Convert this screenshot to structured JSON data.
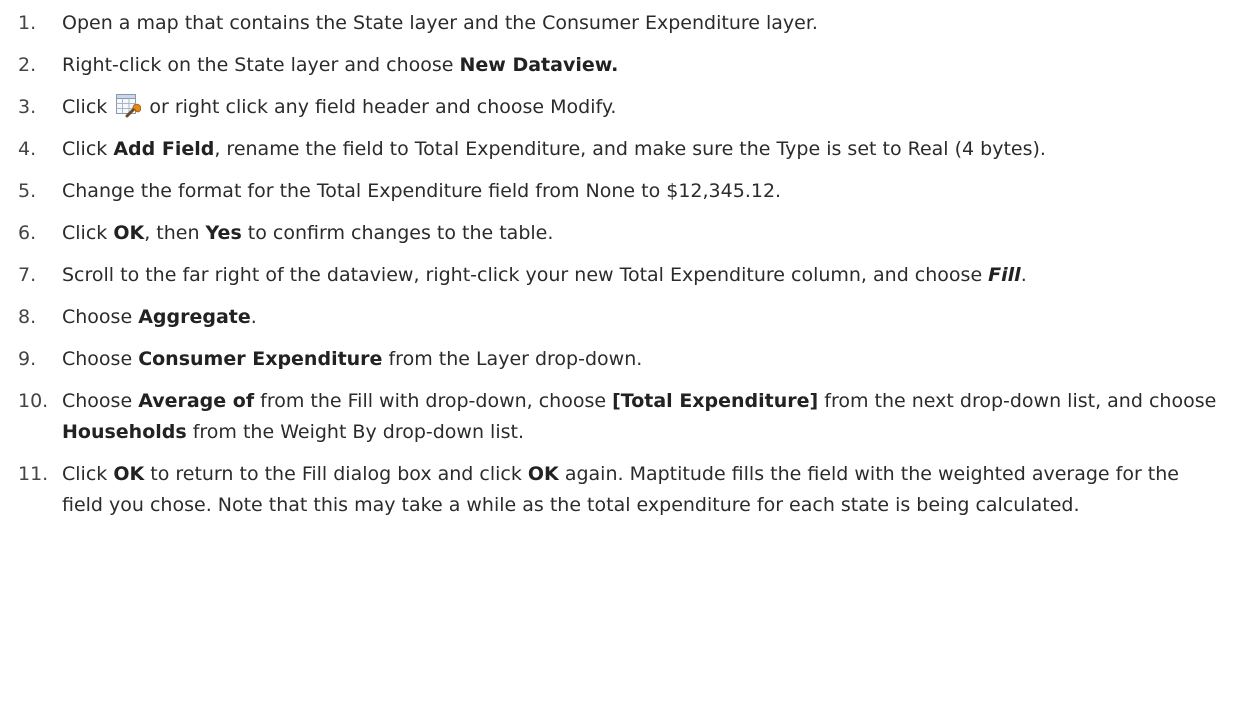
{
  "steps": [
    {
      "num": "1.",
      "parts": [
        {
          "t": "Open a map that contains the State layer and the Consumer Expenditure layer."
        }
      ]
    },
    {
      "num": "2.",
      "parts": [
        {
          "t": "Right-click on the State layer and choose "
        },
        {
          "t": "New Dataview.",
          "b": true
        }
      ]
    },
    {
      "num": "3.",
      "parts": [
        {
          "t": "Click "
        },
        {
          "icon": "modify-table-icon"
        },
        {
          "t": " or right click any field header and choose Modify."
        }
      ]
    },
    {
      "num": "4.",
      "parts": [
        {
          "t": "Click "
        },
        {
          "t": "Add Field",
          "b": true
        },
        {
          "t": ", rename the field to Total Expenditure, and make sure the Type is set to Real (4 bytes)."
        }
      ]
    },
    {
      "num": "5.",
      "parts": [
        {
          "t": "Change the format for the Total Expenditure field from None to $12,345.12."
        }
      ]
    },
    {
      "num": "6.",
      "parts": [
        {
          "t": "Click "
        },
        {
          "t": "OK",
          "b": true
        },
        {
          "t": ", then "
        },
        {
          "t": "Yes",
          "b": true
        },
        {
          "t": " to confirm changes to the table."
        }
      ]
    },
    {
      "num": "7.",
      "parts": [
        {
          "t": "Scroll to the far right of the dataview, right-click your new Total Expenditure column, and choose "
        },
        {
          "t": "Fill",
          "b": true,
          "i": true
        },
        {
          "t": "."
        }
      ]
    },
    {
      "num": "8.",
      "parts": [
        {
          "t": "Choose "
        },
        {
          "t": "Aggregate",
          "b": true
        },
        {
          "t": "."
        }
      ]
    },
    {
      "num": "9.",
      "parts": [
        {
          "t": "Choose "
        },
        {
          "t": "Consumer Expenditure",
          "b": true
        },
        {
          "t": " from the Layer drop-down."
        }
      ]
    },
    {
      "num": "10.",
      "parts": [
        {
          "t": "Choose "
        },
        {
          "t": "Average of",
          "b": true
        },
        {
          "t": " from the Fill with drop-down, choose "
        },
        {
          "t": "[Total Expenditure]",
          "b": true
        },
        {
          "t": " from the next drop-down list, and choose "
        },
        {
          "t": "Households",
          "b": true
        },
        {
          "t": " from the Weight By drop-down list."
        }
      ]
    },
    {
      "num": "11.",
      "parts": [
        {
          "t": "Click "
        },
        {
          "t": "OK",
          "b": true
        },
        {
          "t": " to return to the Fill dialog box and click "
        },
        {
          "t": "OK",
          "b": true
        },
        {
          "t": " again. Maptitude fills the field with the weighted average for the field you chose. Note that this may take a while as the total expenditure for each state is being calculated."
        }
      ]
    }
  ]
}
